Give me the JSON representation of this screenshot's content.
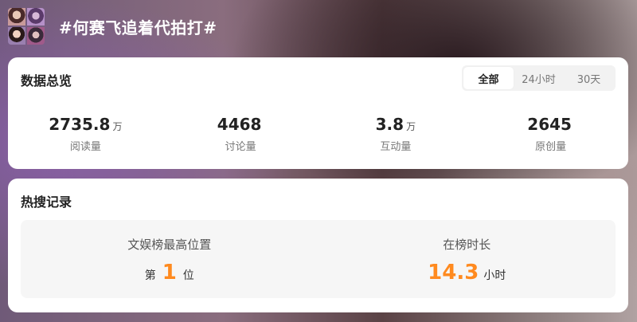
{
  "header": {
    "title": "#何赛飞追着代拍打#"
  },
  "overview": {
    "title": "数据总览",
    "filters": [
      "全部",
      "24小时",
      "30天"
    ],
    "active_filter": "全部",
    "stats": [
      {
        "value": "2735.8",
        "unit": "万",
        "label": "阅读量"
      },
      {
        "value": "4468",
        "unit": "",
        "label": "讨论量"
      },
      {
        "value": "3.8",
        "unit": "万",
        "label": "互动量"
      },
      {
        "value": "2645",
        "unit": "",
        "label": "原创量"
      }
    ]
  },
  "hot_record": {
    "title": "热搜记录",
    "rank_label": "文娱榜最高位置",
    "rank_prefix": "第",
    "rank_value": "1",
    "rank_suffix": "位",
    "duration_label": "在榜时长",
    "duration_value": "14.3",
    "duration_unit": "小时"
  },
  "colors": {
    "accent": "#ff8a1f"
  }
}
